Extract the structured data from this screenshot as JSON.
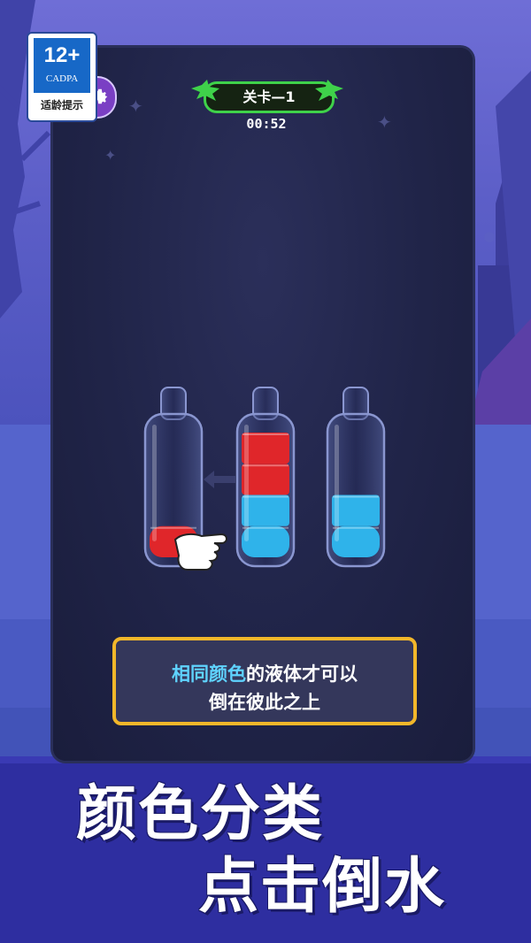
{
  "age_rating": {
    "number": "12+",
    "org": "CADPA",
    "tip": "适龄提示"
  },
  "header": {
    "level": "关卡—1",
    "timer": "00:52"
  },
  "bottles": [
    {
      "position": "left",
      "layers": [
        "red"
      ],
      "fill_fraction": 0.33
    },
    {
      "position": "middle",
      "layers": [
        "red",
        "red",
        "blue",
        "blue"
      ],
      "fill_fraction": 1.0
    },
    {
      "position": "right",
      "layers": [
        "blue",
        "blue"
      ],
      "fill_fraction": 0.5
    }
  ],
  "colors": {
    "red": "#e0262a",
    "blue": "#2fb3ea",
    "accent_green": "#3fd24a",
    "hint_border": "#f2b72a",
    "highlight": "#5fd3ff"
  },
  "hint": {
    "line1_highlight": "相同颜色",
    "line1_rest": "的液体才可以",
    "line2": "倒在彼此之上"
  },
  "promo": {
    "line1": "颜色分类",
    "line2": "点击倒水"
  },
  "icons": {
    "settings": "gear-icon",
    "hand": "pointing-hand-icon",
    "arrow": "arrow-left-icon"
  }
}
